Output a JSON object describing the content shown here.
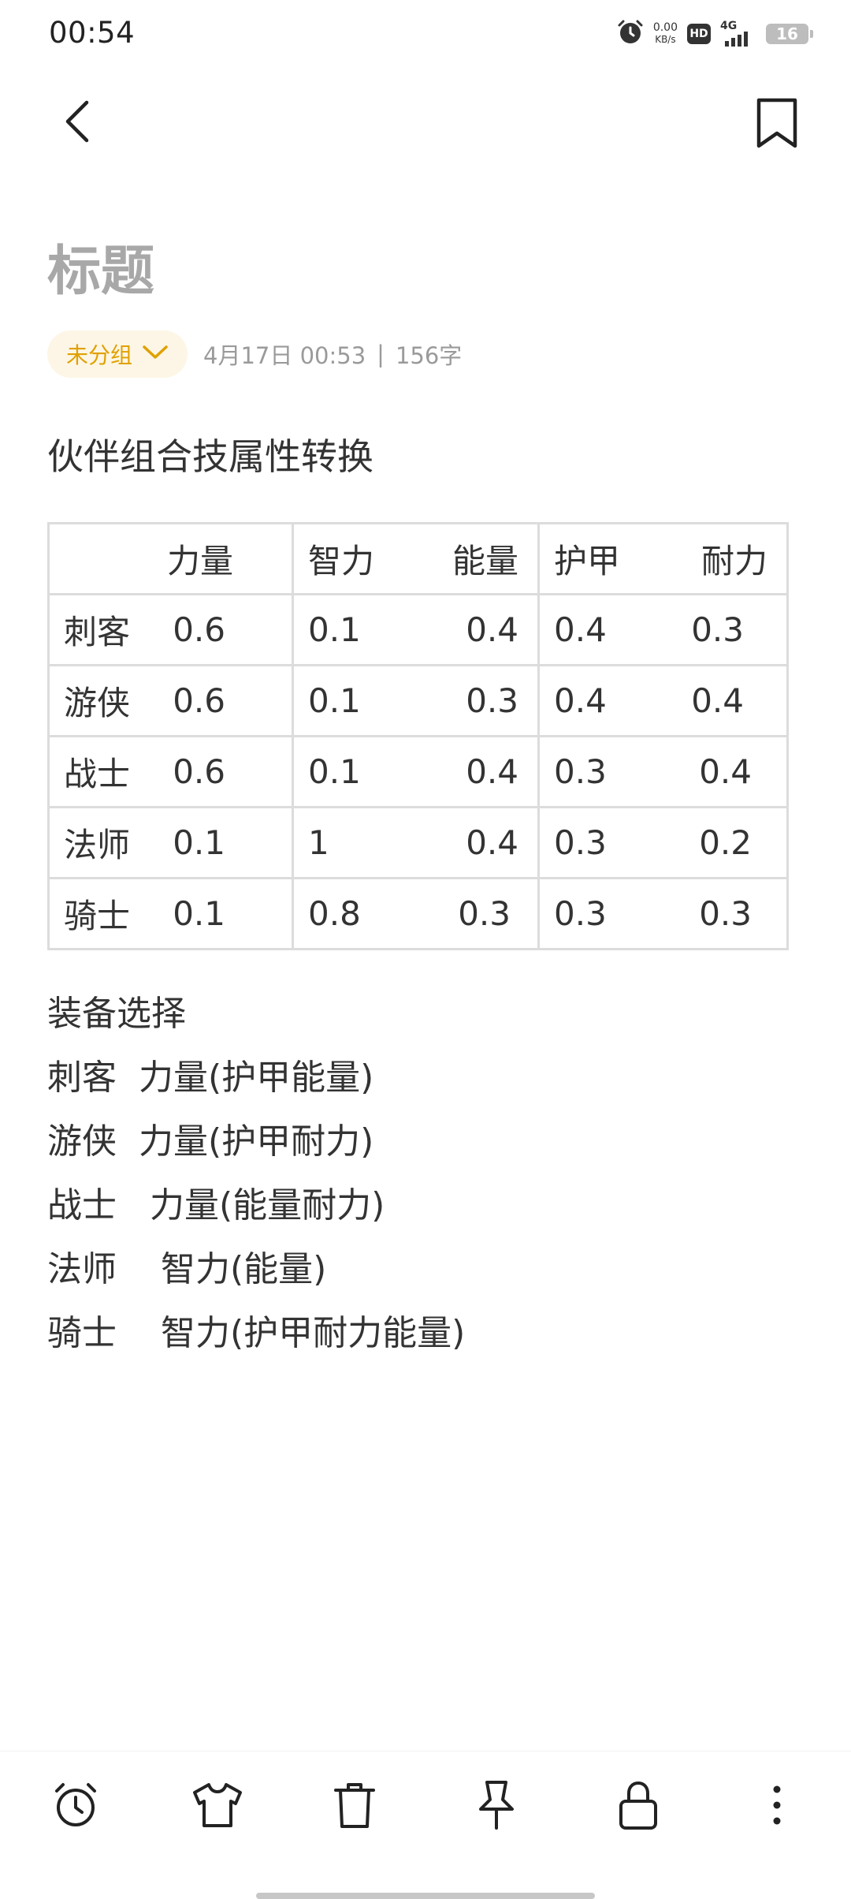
{
  "status_bar": {
    "time": "00:54",
    "net_speed_value": "0.00",
    "net_speed_unit": "KB/s",
    "hd_label": "HD",
    "network_type": "4G",
    "battery_level": "16"
  },
  "nav": {
    "back_icon": "chevron-left-icon",
    "bookmark_icon": "bookmark-icon"
  },
  "note": {
    "title_placeholder": "标题",
    "group_label": "未分组",
    "timestamp": "4月17日 00:53",
    "separator": "|",
    "char_count": "156字",
    "heading": "伙伴组合技属性转换"
  },
  "table": {
    "header": {
      "blank": "",
      "c1": "力量",
      "c2": "智力",
      "c3": "能量",
      "c4": "护甲",
      "c5": "耐力"
    },
    "rows": [
      {
        "name": "刺客",
        "c1": "0.6",
        "c2": "0.1",
        "c3": "0.4",
        "c4": "0.4",
        "c5": "0.3"
      },
      {
        "name": "游侠",
        "c1": "0.6",
        "c2": "0.1",
        "c3": "0.3",
        "c4": "0.4",
        "c5": "0.4"
      },
      {
        "name": "战士",
        "c1": "0.6",
        "c2": "0.1",
        "c3": "0.4",
        "c4": "0.3",
        "c5": "0.4"
      },
      {
        "name": "法师",
        "c1": "0.1",
        "c2": "1",
        "c3": "0.4",
        "c4": "0.3",
        "c5": "0.2"
      },
      {
        "name": "骑士",
        "c1": "0.1",
        "c2": "0.8",
        "c3": "0.3",
        "c4": "0.3",
        "c5": "0.3"
      }
    ]
  },
  "equipment": {
    "heading": "装备选择",
    "lines": [
      "刺客  力量(护甲能量)",
      "游侠  力量(护甲耐力)",
      "战士   力量(能量耐力)",
      "法师    智力(能量)",
      "骑士    智力(护甲耐力能量)"
    ]
  },
  "toolbar": {
    "items": [
      "alarm-clock-icon",
      "shirt-icon",
      "trash-icon",
      "pin-icon",
      "lock-icon",
      "more-vertical-icon"
    ]
  },
  "colors": {
    "accent": "#e0a100",
    "title_placeholder": "#a8a8a8",
    "table_border": "#dcdcdc"
  }
}
